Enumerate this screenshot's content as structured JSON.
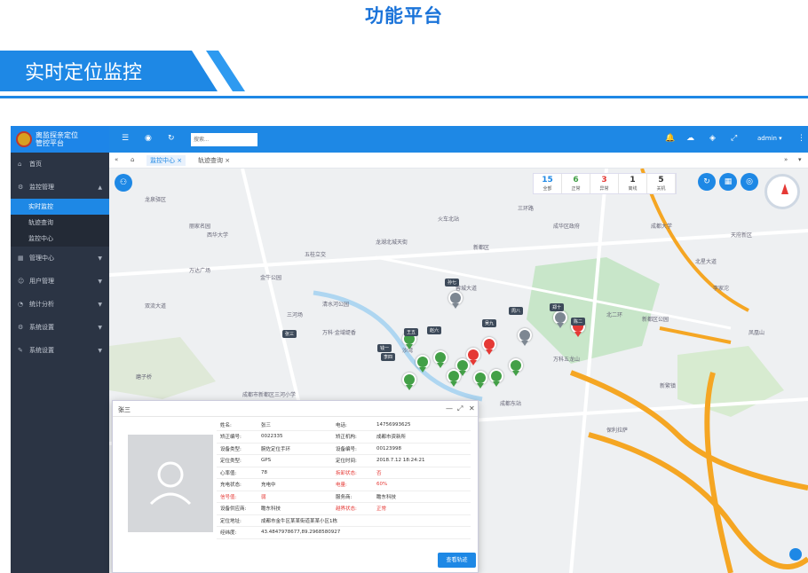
{
  "page_title": "功能平台",
  "section_title": "实时定位监控",
  "app": {
    "logo_line1": "离监探亲定位",
    "logo_line2": "管控平台",
    "search_placeholder": "搜索...",
    "user": "admin ▾"
  },
  "sidebar": {
    "items": [
      {
        "label": "首页"
      },
      {
        "label": "监控管理"
      },
      {
        "label": "实时监控"
      },
      {
        "label": "轨迹查询"
      },
      {
        "label": "监控中心"
      },
      {
        "label": "管理中心"
      },
      {
        "label": "用户管理"
      },
      {
        "label": "统计分析"
      },
      {
        "label": "系统设置"
      },
      {
        "label": "系统设置"
      }
    ]
  },
  "tabs": [
    {
      "label": "监控中心"
    },
    {
      "label": "轨迹查询"
    }
  ],
  "stats": [
    {
      "num": "15",
      "label": "全部",
      "color": "#1e88e5"
    },
    {
      "num": "6",
      "label": "正常",
      "color": "#43a047"
    },
    {
      "num": "3",
      "label": "异常",
      "color": "#e53935"
    },
    {
      "num": "1",
      "label": "离线",
      "color": "#333333"
    },
    {
      "num": "5",
      "label": "关机",
      "color": "#333333"
    }
  ],
  "map_labels": [
    "五桂立交",
    "清水河公园",
    "金牛公园",
    "万科·金域缇香",
    "三河场",
    "成都市新都区三河小学",
    "新都区",
    "北二环",
    "双流大道",
    "万科五龙山",
    "保利拉萨",
    "新都区公园",
    "丽家名园",
    "蓉城大道",
    "北星大道",
    "龙湖北城天街",
    "成都大学",
    "天府新区",
    "三环路",
    "火车北站",
    "磨子桥",
    "西华大学",
    "成华区政府",
    "新繁镇",
    "沙湾",
    "李家沱",
    "万达广场",
    "凤凰山",
    "龙泉驿区",
    "成都东站"
  ],
  "person_tags": [
    "张三",
    "李四",
    "王五",
    "赵六",
    "孙七",
    "周八",
    "吴九",
    "郑十",
    "钱一",
    "陈二"
  ],
  "dialog": {
    "title": "张三",
    "rows": [
      {
        "k1": "姓名:",
        "v1": "张三",
        "k2": "电话:",
        "v2": "14756993625"
      },
      {
        "k1": "矫正编号:",
        "v1": "0022335",
        "k2": "矫正机构:",
        "v2": "成都市资新所"
      },
      {
        "k1": "设备类型:",
        "v1": "腕佐定位手环",
        "k2": "设备编号:",
        "v2": "00123998"
      },
      {
        "k1": "定位类型:",
        "v1": "GPS",
        "k2": "定位时间:",
        "v2": "2018.7.12 18:24:21"
      },
      {
        "k1": "心率值:",
        "v1": "78",
        "k2": "拆卸状态:",
        "v2": "否"
      },
      {
        "k1": "充电状态:",
        "v1": "充电中",
        "k2": "电量:",
        "v2": "60%"
      },
      {
        "k1": "信号值:",
        "v1": "弱",
        "k2": "服务商:",
        "v2": "瞻东科技"
      },
      {
        "k1": "设备供应商:",
        "v1": "瞻东科技",
        "k2": "越界状态:",
        "v2": "正常"
      }
    ],
    "address_label": "定位地址:",
    "address": "成都市金牛区某某街道某某小区1栋",
    "coord_label": "经纬度:",
    "coord": "43.4847978677,89.2968580927",
    "button": "查看轨迹"
  }
}
